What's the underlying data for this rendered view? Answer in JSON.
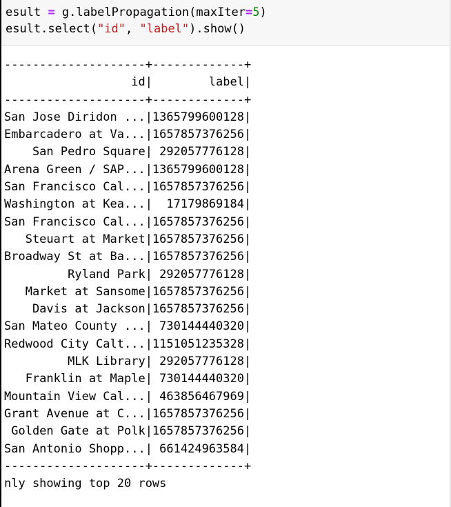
{
  "code": {
    "line1": {
      "var": "esult",
      "op": "=",
      "call": " g.labelPropagation(maxIter",
      "kw_op": "=",
      "num": "5",
      "close": ")"
    },
    "line2": {
      "pre": "esult.select(",
      "str1": "\"id\"",
      "sep": ", ",
      "str2": "\"label\"",
      "post": ").show()"
    }
  },
  "table": {
    "border_top": "--------------------+-------------+",
    "header": "                  id|        label|",
    "border_mid": "--------------------+-------------+",
    "rows": [
      "San Jose Diridon ...|1365799600128|",
      "Embarcadero at Va...|1657857376256|",
      "    San Pedro Square| 292057776128|",
      "Arena Green / SAP...|1365799600128|",
      "San Francisco Cal...|1657857376256|",
      "Washington at Kea...|  17179869184|",
      "San Francisco Cal...|1657857376256|",
      "   Steuart at Market|1657857376256|",
      "Broadway St at Ba...|1657857376256|",
      "         Ryland Park| 292057776128|",
      "   Market at Sansome|1657857376256|",
      "    Davis at Jackson|1657857376256|",
      "San Mateo County ...| 730144440320|",
      "Redwood City Calt...|1151051235328|",
      "         MLK Library| 292057776128|",
      "   Franklin at Maple| 730144440320|",
      "Mountain View Cal...| 463856467969|",
      "Grant Avenue at C...|1657857376256|",
      " Golden Gate at Polk|1657857376256|",
      "San Antonio Shopp...| 661424963584|"
    ],
    "border_bottom": "--------------------+-------------+",
    "footer": "nly showing top 20 rows"
  }
}
